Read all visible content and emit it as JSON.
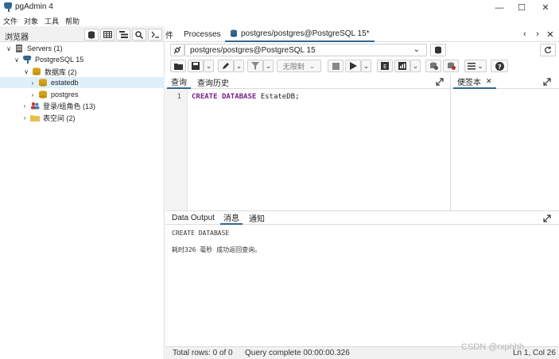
{
  "window": {
    "title": "pgAdmin 4",
    "min": "—",
    "max": "☐",
    "close": "✕"
  },
  "menu": [
    "文件",
    "对象",
    "工具",
    "帮助"
  ],
  "browser": {
    "label": "浏览器",
    "tree": [
      {
        "label": "Servers (1)",
        "chev": "∨"
      },
      {
        "label": "PostgreSQL 15",
        "chev": "∨"
      },
      {
        "label": "数据库 (2)",
        "chev": "∨"
      },
      {
        "label": "estatedb",
        "chev": "›"
      },
      {
        "label": "postgres",
        "chev": "›"
      },
      {
        "label": "登录/组角色 (13)",
        "chev": "›"
      },
      {
        "label": "表空间 (2)",
        "chev": "›"
      }
    ]
  },
  "tabs": {
    "partial": "件",
    "processes": "Processes",
    "query": "postgres/postgres@PostgreSQL 15*"
  },
  "nav": {
    "prev": "‹",
    "next": "›",
    "close": "✕"
  },
  "connection": {
    "value": "postgres/postgres@PostgreSQL 15",
    "chevron": "⌄"
  },
  "toolbar": {
    "limit": "无限制"
  },
  "editor": {
    "tab_query": "查询",
    "tab_history": "查询历史",
    "line_number": "1",
    "code_kw1": "CREATE",
    "code_kw2": "DATABASE",
    "code_rest": "EstateDB;"
  },
  "scratch": {
    "label": "便签本",
    "close": "✕"
  },
  "results": {
    "tab_output": "Data Output",
    "tab_messages": "消息",
    "tab_notify": "通知",
    "line1": "CREATE DATABASE",
    "line2": "耗时326 毫秒 成功返回查询。"
  },
  "status": {
    "rows": "Total rows: 0 of 0",
    "query": "Query complete 00:00:00.326",
    "position": "Ln 1, Col 26"
  },
  "watermark": "CSDN @rxphhh"
}
